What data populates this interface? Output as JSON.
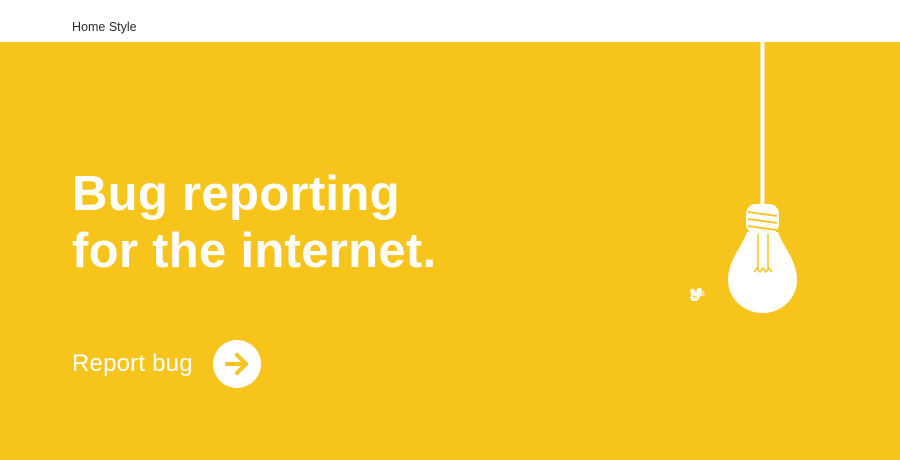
{
  "header": {
    "breadcrumb": "Home Style"
  },
  "hero": {
    "headline_line1": "Bug reporting",
    "headline_line2": "for the internet.",
    "cta_label": "Report bug"
  },
  "icons": {
    "cta": "arrow-right-icon",
    "illustration": "lightbulb-icon",
    "decoration": "bee-icon"
  },
  "colors": {
    "hero_background": "#f7c41c",
    "text": "#ffffff",
    "accent": "#f7c41c"
  }
}
